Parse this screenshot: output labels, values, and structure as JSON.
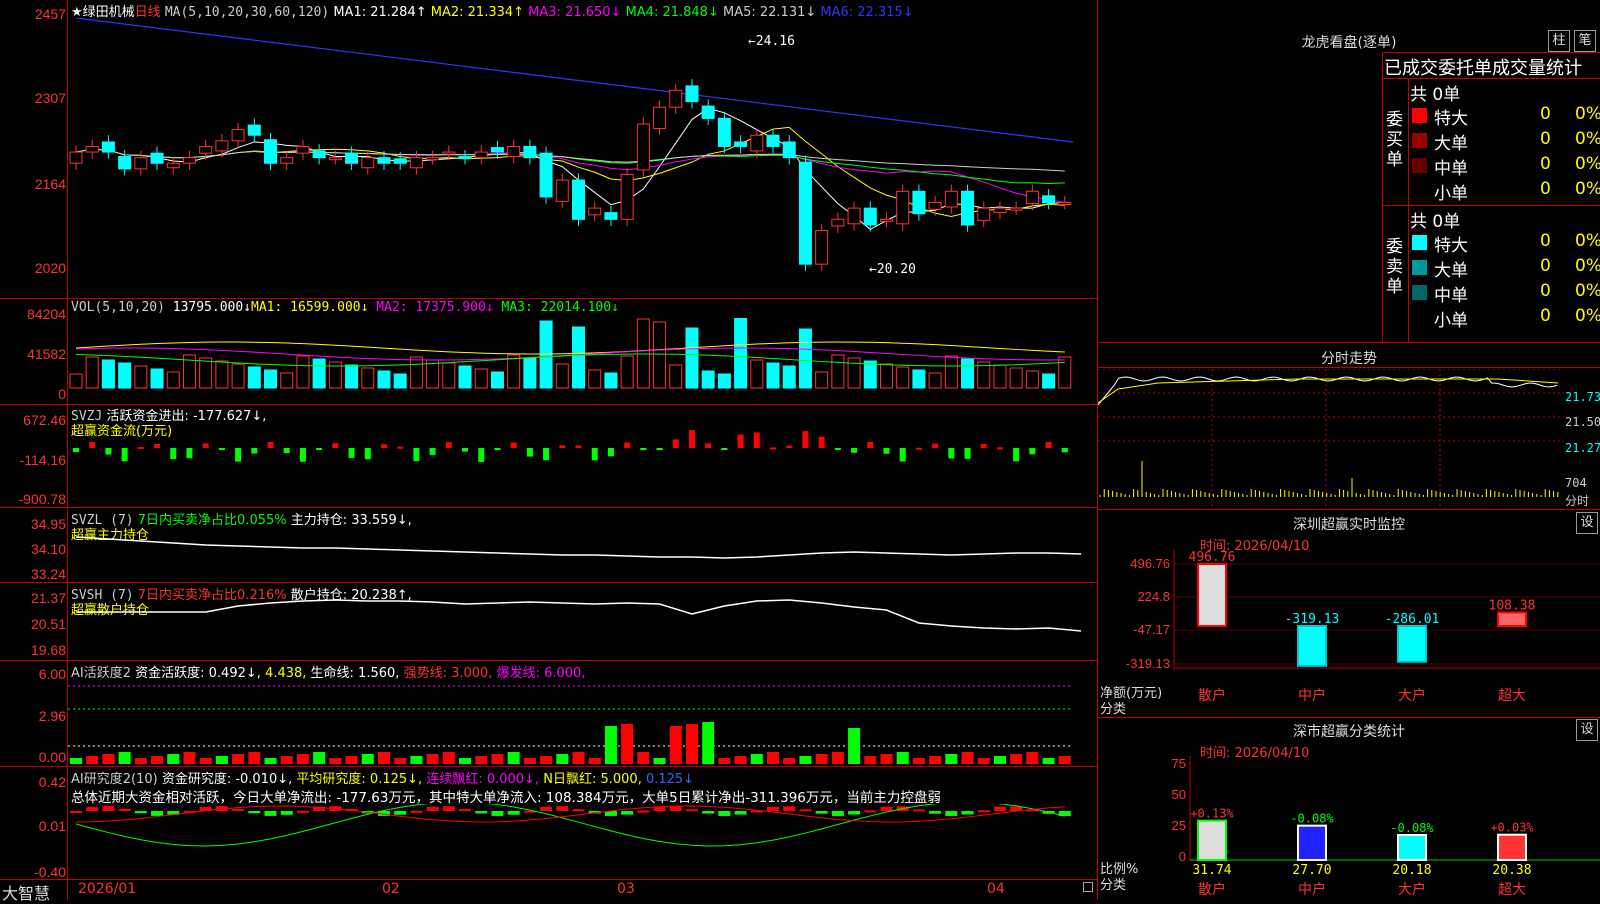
{
  "stock": {
    "star": "★",
    "name": "绿田机械",
    "period": "日线"
  },
  "ma_header": {
    "label": "MA(5,10,20,30,60,120)",
    "items": [
      {
        "text": "MA1: 21.284↑",
        "color": "#ffffff"
      },
      {
        "text": "MA2: 21.334↑",
        "color": "#ffff00"
      },
      {
        "text": "MA3: 21.650↓",
        "color": "#ff00ff"
      },
      {
        "text": "MA4: 21.848↓",
        "color": "#00ff00"
      },
      {
        "text": "MA5: 22.131↓",
        "color": "#cccccc"
      },
      {
        "text": "MA6: 22.315↓",
        "color": "#3333ff"
      }
    ]
  },
  "price_axis": [
    "2457",
    "2307",
    "2164",
    "2020"
  ],
  "price_annotations": {
    "high": "24.16",
    "low": "20.20"
  },
  "vol_header": {
    "label": "VOL(5,10,20)",
    "value": "13795.000↓",
    "items": [
      {
        "text": "MA1: 16599.000↓",
        "color": "#ffff00"
      },
      {
        "text": "MA2: 17375.900↓",
        "color": "#ff00ff"
      },
      {
        "text": "MA3: 22014.100↓",
        "color": "#00ff00"
      }
    ]
  },
  "vol_axis": [
    "84204",
    "41582",
    "0"
  ],
  "svzj": {
    "label": "SVZJ",
    "text": "活跃资金进出: -177.627↓,",
    "sub": "超赢资金流(万元)",
    "axis": [
      "672.46",
      "-114.16",
      "-900.78"
    ]
  },
  "svzl": {
    "label": "SVZL (7)",
    "green": "7日内买卖净占比0.055%",
    "white": "主力持仓: 33.559↓,",
    "sub": "超赢主力持仓",
    "axis": [
      "34.95",
      "34.10",
      "33.24"
    ]
  },
  "svsh": {
    "label": "SVSH (7)",
    "red": "7日内买卖净占比0.216%",
    "white": "散户持仓: 20.238↑,",
    "sub": "超赢散户持仓",
    "axis": [
      "21.37",
      "20.51",
      "19.68"
    ]
  },
  "ai1": {
    "label": "AI活跃度2",
    "t1": "资金活跃度: 0.492↓,",
    "t2": "4.438,",
    "t3": "生命线: 1.560,",
    "t4": "强势线: 3.000,",
    "t5": "爆发线: 6.000,",
    "axis": [
      "6.00",
      "2.96",
      "0.00"
    ]
  },
  "ai2": {
    "label": "AI研究度2(10)",
    "t1": "资金研究度: -0.010↓,",
    "t2": "平均研究度: 0.125↓,",
    "t3": "连续飘红: 0.000↓,",
    "t4": "N日飘红: 5.000,",
    "t5": "0.125↓",
    "summary": "总体近期大资金相对活跃，今日大单净流出: -177.63万元，其中特大单净流入: 108.384万元，大单5日累计净出-311.396万元，当前主力控盘弱",
    "axis": [
      "0.42",
      "0.01",
      "-0.40"
    ]
  },
  "x_axis": {
    "brand": "大智慧",
    "labels": [
      "2026/01",
      "02",
      "03",
      "04"
    ]
  },
  "lhb": {
    "title": "龙虎看盘(逐单)",
    "btn1": "柱",
    "btn2": "笔",
    "subtitle": "已成交委托单成交量统计",
    "buy": {
      "side": "委买单",
      "total": "共 0单",
      "rows": [
        {
          "label": "特大",
          "v": "0",
          "p": "0%",
          "color": "#ff0000"
        },
        {
          "label": "大单",
          "v": "0",
          "p": "0%",
          "color": "#990000"
        },
        {
          "label": "中单",
          "v": "0",
          "p": "0%",
          "color": "#660000"
        },
        {
          "label": "小单",
          "v": "0",
          "p": "0%",
          "color": "#000000"
        }
      ]
    },
    "sell": {
      "side": "委卖单",
      "total": "共 0单",
      "rows": [
        {
          "label": "特大",
          "v": "0",
          "p": "0%",
          "color": "#00ffff"
        },
        {
          "label": "大单",
          "v": "0",
          "p": "0%",
          "color": "#009999"
        },
        {
          "label": "中单",
          "v": "0",
          "p": "0%",
          "color": "#006666"
        },
        {
          "label": "小单",
          "v": "0",
          "p": "0%",
          "color": "#000000"
        }
      ]
    }
  },
  "fenshi": {
    "title": "分时走势",
    "axis": [
      "21.73",
      "21.50",
      "21.27"
    ],
    "vol_axis": [
      "704",
      "分时"
    ]
  },
  "monitor": {
    "title": "深圳超赢实时监控",
    "btn": "设",
    "date": "时间: 2026/04/10",
    "ylabel": "净额(万元)",
    "xlabel": "分类",
    "axis": [
      "496.76",
      "224.8",
      "-47.17",
      "-319.13"
    ],
    "bars": [
      {
        "name": "散户",
        "value": 496.76,
        "label": "496.76"
      },
      {
        "name": "中户",
        "value": -319.13,
        "label": "-319.13"
      },
      {
        "name": "大户",
        "value": -286.01,
        "label": "-286.01"
      },
      {
        "name": "超大",
        "value": 108.38,
        "label": "108.38"
      }
    ]
  },
  "classify": {
    "title": "深市超赢分类统计",
    "btn": "设",
    "date": "时间: 2026/04/10",
    "ylabel": "比例%",
    "xlabel": "分类",
    "axis": [
      "75",
      "50",
      "25",
      "0"
    ],
    "bars": [
      {
        "name": "散户",
        "value": 31.74,
        "label": "31.74",
        "chg": "+0.13%"
      },
      {
        "name": "中户",
        "value": 27.7,
        "label": "27.70",
        "chg": "-0.08%"
      },
      {
        "name": "大户",
        "value": 20.18,
        "label": "20.18",
        "chg": "-0.08%"
      },
      {
        "name": "超大",
        "value": 20.38,
        "label": "20.38",
        "chg": "+0.03%"
      }
    ]
  }
}
